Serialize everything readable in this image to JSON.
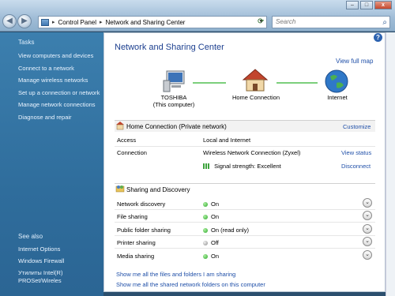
{
  "window": {
    "address": [
      "Control Panel",
      "Network and Sharing Center"
    ],
    "search_placeholder": "Search",
    "min_glyph": "–",
    "max_glyph": "□",
    "close_glyph": "x"
  },
  "tasks": {
    "title": "Tasks",
    "items": [
      "View computers and devices",
      "Connect to a network",
      "Manage wireless networks",
      "Set up a connection or network",
      "Manage network connections",
      "Diagnose and repair"
    ]
  },
  "see_also": {
    "title": "See also",
    "items": [
      "Internet Options",
      "Windows Firewall",
      "Утилиты Intel(R)",
      "PROSet/Wireles"
    ]
  },
  "main": {
    "title": "Network and Sharing Center",
    "view_full_map": "View full map",
    "help": "?",
    "map_nodes": [
      {
        "label": "TOSHIBA",
        "sub": "(This computer)",
        "icon": "computer-icon"
      },
      {
        "label": "Home Connection",
        "sub": "",
        "icon": "house-icon"
      },
      {
        "label": "Internet",
        "sub": "",
        "icon": "globe-icon"
      }
    ],
    "connection": {
      "name": "Home Connection",
      "type": "(Private network)",
      "customize": "Customize",
      "access_label": "Access",
      "access_value": "Local and Internet",
      "connection_label": "Connection",
      "connection_value": "Wireless Network Connection (Zyxel)",
      "view_status": "View status",
      "signal_label": "Signal strength:",
      "signal_value": "Excellent",
      "disconnect": "Disconnect"
    },
    "sharing": {
      "title": "Sharing and Discovery",
      "rows": [
        {
          "label": "Network discovery",
          "value": "On",
          "state": "on"
        },
        {
          "label": "File sharing",
          "value": "On",
          "state": "on"
        },
        {
          "label": "Public folder sharing",
          "value": "On (read only)",
          "state": "on"
        },
        {
          "label": "Printer sharing",
          "value": "Off",
          "state": "off"
        },
        {
          "label": "Media sharing",
          "value": "On",
          "state": "on"
        }
      ]
    },
    "bottom_links": [
      "Show me all the files and folders I am sharing",
      "Show me all the shared network folders on this computer"
    ]
  },
  "colors": {
    "on": "#2aa62a",
    "off": "#8a8a8a",
    "link": "#1f4fa8",
    "sidebar": "#2f6d9c"
  }
}
